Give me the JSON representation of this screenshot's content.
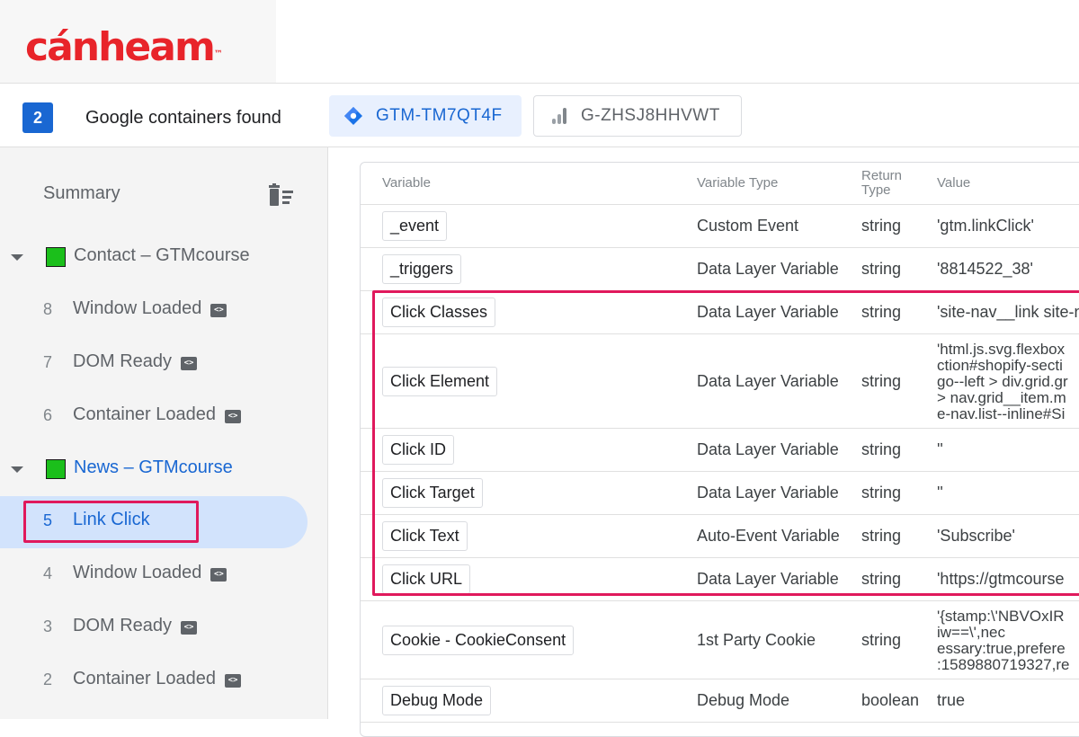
{
  "brand": {
    "logo_text": "cánheam",
    "logo_mark": "™",
    "color": "#e8242a"
  },
  "header": {
    "container_count": "2",
    "found_label": "Google containers found",
    "gtm_container": "GTM-TM7QT4F",
    "ga_container": "G-ZHSJ8HHVWT"
  },
  "sidebar": {
    "summary_label": "Summary",
    "groups": [
      {
        "label": "Contact – GTMcourse",
        "events": [
          {
            "num": "8",
            "label": "Window Loaded"
          },
          {
            "num": "7",
            "label": "DOM Ready"
          },
          {
            "num": "6",
            "label": "Container Loaded"
          }
        ]
      },
      {
        "label": "News – GTMcourse",
        "events": [
          {
            "num": "5",
            "label": "Link Click"
          },
          {
            "num": "4",
            "label": "Window Loaded"
          },
          {
            "num": "3",
            "label": "DOM Ready"
          },
          {
            "num": "2",
            "label": "Container Loaded"
          }
        ]
      }
    ]
  },
  "table": {
    "headers": {
      "variable": "Variable",
      "type": "Variable Type",
      "return_type_1": "Return",
      "return_type_2": "Type",
      "value": "Value"
    },
    "rows": [
      {
        "name": "_event",
        "type": "Custom Event",
        "ret": "string",
        "value": [
          "'gtm.linkClick'"
        ]
      },
      {
        "name": "_triggers",
        "type": "Data Layer Variable",
        "ret": "string",
        "value": [
          "'8814522_38'"
        ]
      },
      {
        "name": "Click Classes",
        "type": "Data Layer Variable",
        "ret": "string",
        "value": [
          "'site-nav__link site-n"
        ]
      },
      {
        "name": "Click Element",
        "type": "Data Layer Variable",
        "ret": "string",
        "value": [
          "'html.js.svg.flexbox",
          "ction#shopify-secti",
          "go--left > div.grid.gr",
          " > nav.grid__item.m",
          "e-nav.list--inline#Si"
        ]
      },
      {
        "name": "Click ID",
        "type": "Data Layer Variable",
        "ret": "string",
        "value": [
          "''"
        ]
      },
      {
        "name": "Click Target",
        "type": "Data Layer Variable",
        "ret": "string",
        "value": [
          "''"
        ]
      },
      {
        "name": "Click Text",
        "type": "Auto-Event Variable",
        "ret": "string",
        "value": [
          "'Subscribe'"
        ]
      },
      {
        "name": "Click URL",
        "type": "Data Layer Variable",
        "ret": "string",
        "value": [
          "'https://gtmcourse"
        ]
      },
      {
        "name": "Cookie - CookieConsent",
        "type": "1st Party Cookie",
        "ret": "string",
        "value": [
          "'{stamp:\\'NBVOxIR",
          "iw==\\',nec",
          "essary:true,prefere",
          ":1589880719327,re"
        ]
      },
      {
        "name": "Debug Mode",
        "type": "Debug Mode",
        "ret": "boolean",
        "value": [
          "true"
        ]
      }
    ]
  }
}
